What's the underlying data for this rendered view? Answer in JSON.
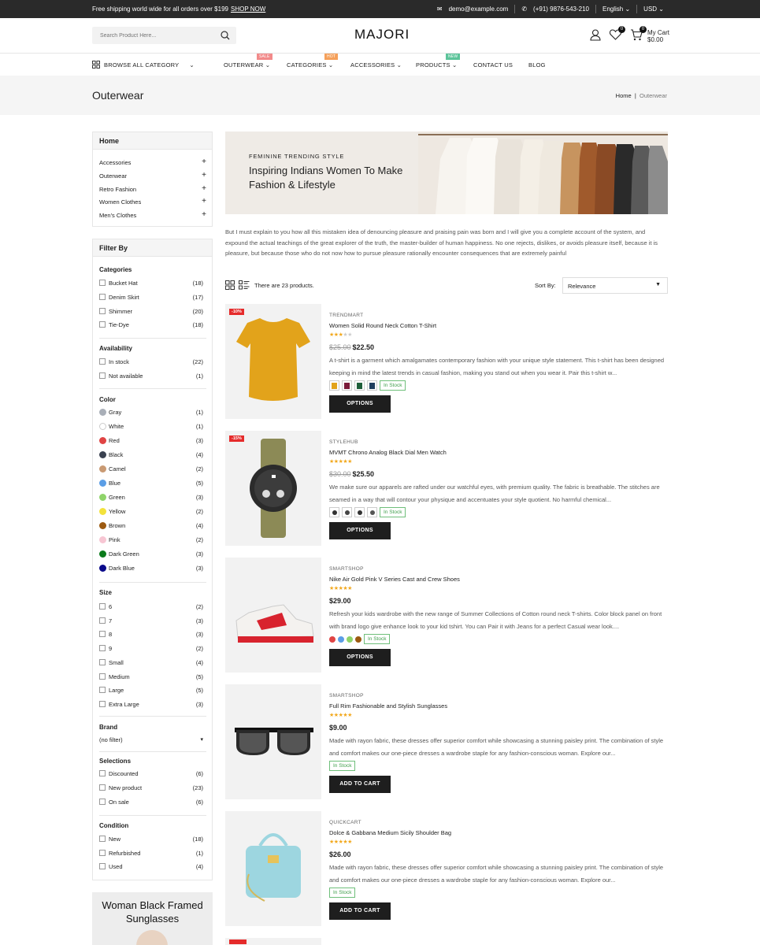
{
  "topbar": {
    "shipping": "Free shipping world wide for all orders over $199",
    "shop_now": "SHOP NOW",
    "email": "demo@example.com",
    "phone": "(+91) 9876-543-210",
    "language": "English",
    "currency": "USD"
  },
  "header": {
    "search_placeholder": "Search Product Here...",
    "logo": "MAJORI",
    "wishlist_count": "0",
    "cart_count": "0",
    "cart_label": "My Cart",
    "cart_total": "$0.00"
  },
  "nav": {
    "browse": "BROWSE ALL CATEGORY",
    "items": [
      {
        "label": "OUTERWEAR",
        "tag": "SALE",
        "tag_color": "#f28a8a"
      },
      {
        "label": "CATEGORIES",
        "tag": "HOT",
        "tag_color": "#f5a05a"
      },
      {
        "label": "ACCESSORIES"
      },
      {
        "label": "PRODUCTS",
        "tag": "NEW",
        "tag_color": "#5cc49a"
      },
      {
        "label": "CONTACT US"
      },
      {
        "label": "BLOG"
      }
    ]
  },
  "page": {
    "title": "Outerwear",
    "breadcrumb_home": "Home",
    "breadcrumb_sep": "|",
    "breadcrumb_current": "Outerwear"
  },
  "sidebar": {
    "home": "Home",
    "categories": [
      "Accessories",
      "Outerwear",
      "Retro Fashion",
      "Women Clothes",
      "Men's Clothes"
    ],
    "filter_title": "Filter By",
    "categories_title": "Categories",
    "category_filters": [
      {
        "label": "Bucket Hat",
        "count": "(18)"
      },
      {
        "label": "Denim Skirt",
        "count": "(17)"
      },
      {
        "label": "Shimmer",
        "count": "(20)"
      },
      {
        "label": "Tie-Dye",
        "count": "(18)"
      }
    ],
    "availability_title": "Availability",
    "availability": [
      {
        "label": "In stock",
        "count": "(22)"
      },
      {
        "label": "Not available",
        "count": "(1)"
      }
    ],
    "color_title": "Color",
    "colors": [
      {
        "label": "Gray",
        "count": "(1)",
        "hex": "#a9afb8"
      },
      {
        "label": "White",
        "count": "(1)",
        "hex": "#ffffff"
      },
      {
        "label": "Red",
        "count": "(3)",
        "hex": "#e04444"
      },
      {
        "label": "Black",
        "count": "(4)",
        "hex": "#3a4150"
      },
      {
        "label": "Camel",
        "count": "(2)",
        "hex": "#c99a73"
      },
      {
        "label": "Blue",
        "count": "(5)",
        "hex": "#5b9ee6"
      },
      {
        "label": "Green",
        "count": "(3)",
        "hex": "#8fd46a"
      },
      {
        "label": "Yellow",
        "count": "(2)",
        "hex": "#f3e23b"
      },
      {
        "label": "Brown",
        "count": "(4)",
        "hex": "#9c5a10"
      },
      {
        "label": "Pink",
        "count": "(2)",
        "hex": "#f7c6d3"
      },
      {
        "label": "Dark Green",
        "count": "(3)",
        "hex": "#0b7a1b"
      },
      {
        "label": "Dark Blue",
        "count": "(3)",
        "hex": "#0a0a8a"
      }
    ],
    "size_title": "Size",
    "sizes": [
      {
        "label": "6",
        "count": "(2)"
      },
      {
        "label": "7",
        "count": "(3)"
      },
      {
        "label": "8",
        "count": "(3)"
      },
      {
        "label": "9",
        "count": "(2)"
      },
      {
        "label": "Small",
        "count": "(4)"
      },
      {
        "label": "Medium",
        "count": "(5)"
      },
      {
        "label": "Large",
        "count": "(5)"
      },
      {
        "label": "Extra Large",
        "count": "(3)"
      }
    ],
    "brand_title": "Brand",
    "brand_value": "(no filter)",
    "selections_title": "Selections",
    "selections": [
      {
        "label": "Discounted",
        "count": "(6)"
      },
      {
        "label": "New product",
        "count": "(23)"
      },
      {
        "label": "On sale",
        "count": "(6)"
      }
    ],
    "condition_title": "Condition",
    "conditions": [
      {
        "label": "New",
        "count": "(18)"
      },
      {
        "label": "Refurbished",
        "count": "(1)"
      },
      {
        "label": "Used",
        "count": "(4)"
      }
    ],
    "promo": "Woman Black Framed Sunglasses"
  },
  "banner": {
    "kicker": "FEMININE TRENDING STYLE",
    "title": "Inspiring Indians Women To Make Fashion & Lifestyle"
  },
  "description": "But I must explain to you how all this mistaken idea of denouncing pleasure and praising pain was born and I will give you a complete account of the system, and expound the actual teachings of the great explorer of the truth, the master-builder of human happiness. No one rejects, dislikes, or avoids pleasure itself, because it is pleasure, but because those who do not now how to pursue pleasure rationally encounter consequences that are extremely painful",
  "toolbar": {
    "count": "There are 23 products.",
    "sort_label": "Sort By:",
    "sort_value": "Relevance"
  },
  "products": [
    {
      "discount": "-10%",
      "brand": "TRENDMART",
      "name": "Women Solid Round Neck Cotton T-Shirt",
      "rating": 3,
      "old_price": "$25.00",
      "price": "$22.50",
      "desc": "A t-shirt is a garment which amalgamates contemporary fashion with your unique style statement. This t-shirt has been designed keeping in mind the latest trends in casual fashion, making you stand out when you wear it. Pair this t-shirt w...",
      "stock": "In Stock",
      "button": "OPTIONS",
      "swatch": "tshirt",
      "thumbs": [
        "#e2a31b",
        "#7b1b3a",
        "#1f5e3a",
        "#1f3e5e"
      ]
    },
    {
      "discount": "-15%",
      "brand": "STYLEHUB",
      "name": "MVMT Chrono Analog Black Dial Men Watch",
      "rating": 5,
      "old_price": "$30.00",
      "price": "$25.50",
      "desc": "We make sure our apparels are rafted under our watchful eyes, with premium quality. The fabric is breathable. The stitches are seamed in a way that will contour your physique and accentuates your style quotient. No harmful chemical...",
      "stock": "In Stock",
      "button": "OPTIONS",
      "swatch": "watch",
      "thumbs": [
        "#333",
        "#444",
        "#333",
        "#555"
      ]
    },
    {
      "brand": "SMARTSHOP",
      "name": "Nike Air Gold Pink V Series Cast and Crew Shoes",
      "rating": 5,
      "price": "$29.00",
      "desc": "Refresh your kids wardrobe with the new range of Summer Collections of Cotton round neck T-shirts. Color block panel on front with brand logo give enhance look to your kid tshirt. You can Pair it with Jeans for a perfect Casual wear look....",
      "stock": "In Stock",
      "button": "OPTIONS",
      "swatch": "dots",
      "dots": [
        "#e04444",
        "#5b9ee6",
        "#8fd46a",
        "#9c5a10"
      ]
    },
    {
      "brand": "SMARTSHOP",
      "name": "Full Rim Fashionable and Stylish Sunglasses",
      "rating": 5,
      "price": "$9.00",
      "desc": "Made with rayon fabric, these dresses offer superior comfort while showcasing a stunning paisley print. The combination of style and comfort makes our one-piece dresses a wardrobe staple for any fashion-conscious woman. Explore our...",
      "stock": "In Stock",
      "button": "ADD TO CART",
      "swatch": "none"
    },
    {
      "brand": "QUICKCART",
      "name": "Dolce & Gabbana Medium Sicily Shoulder Bag",
      "rating": 5,
      "price": "$26.00",
      "desc": "Made with rayon fabric, these dresses offer superior comfort while showcasing a stunning paisley print. The combination of style and comfort makes our one-piece dresses a wardrobe staple for any fashion-conscious woman. Explore our...",
      "stock": "In Stock",
      "button": "ADD TO CART",
      "swatch": "none"
    }
  ]
}
